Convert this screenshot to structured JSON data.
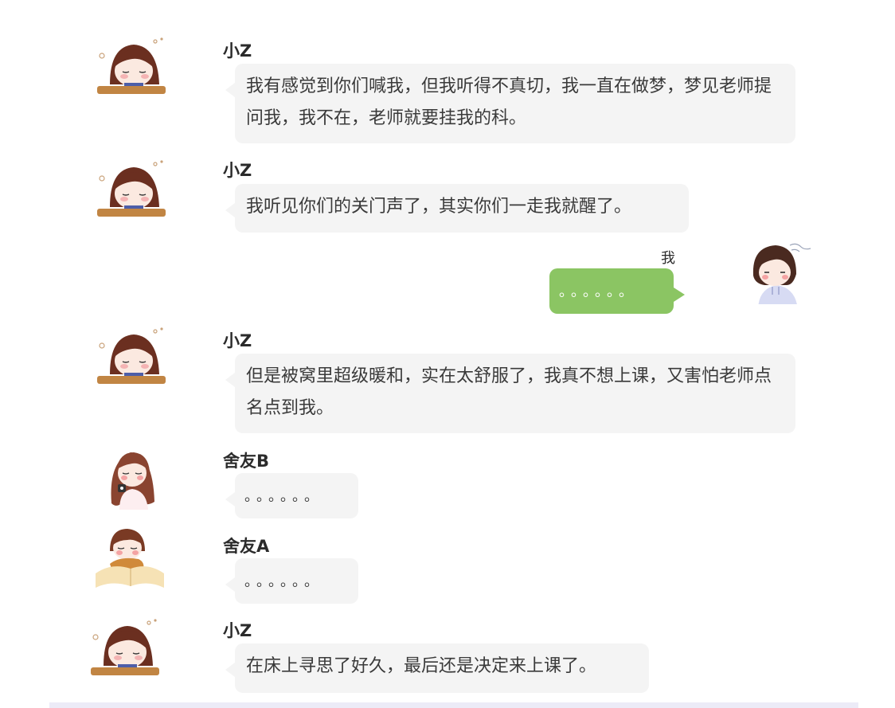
{
  "messages": [
    {
      "sender": "小Z",
      "avatar": "sleepy-girl-desk-avatar",
      "text": "我有感觉到你们喊我，但我听得不真切，我一直在做梦，梦见老师提问我，我不在，老师就要挂我的科。"
    },
    {
      "sender": "小Z",
      "avatar": "sleepy-girl-desk-avatar",
      "text": "我听见你们的关门声了，其实你们一走我就醒了。"
    },
    {
      "sender": "我",
      "avatar": "hoodie-girl-avatar",
      "text": "。。。。。。"
    },
    {
      "sender": "小Z",
      "avatar": "sleepy-girl-desk-avatar",
      "text": "但是被窝里超级暖和，实在太舒服了，我真不想上课，又害怕老师点名点到我。"
    },
    {
      "sender": "舍友B",
      "avatar": "long-hair-girl-avatar",
      "text": "。。。。。。"
    },
    {
      "sender": "舍友A",
      "avatar": "girl-on-book-avatar",
      "text": "。。。。。。"
    },
    {
      "sender": "小Z",
      "avatar": "sleepy-girl-desk-avatar",
      "text": "在床上寻思了好久，最后还是决定来上课了。"
    }
  ],
  "colors": {
    "my_bubble": "#8bc563",
    "other_bubble": "#f4f4f4",
    "footer_bar": "#ecebf7"
  }
}
